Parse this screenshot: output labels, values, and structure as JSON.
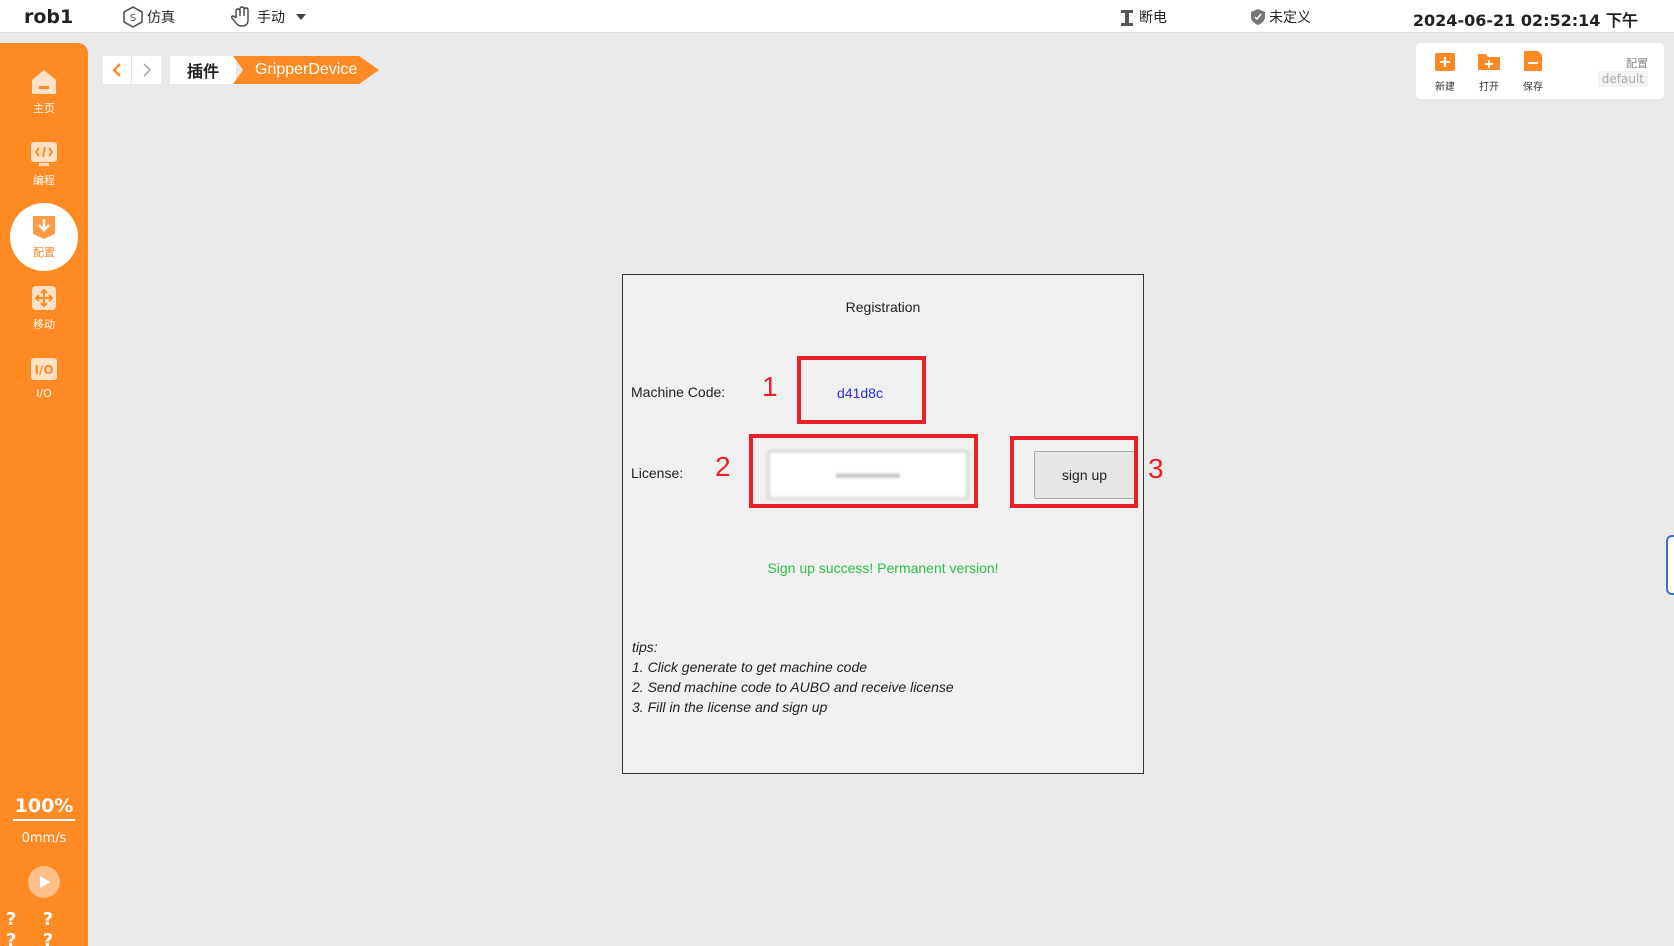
{
  "topbar": {
    "robot_name": "rob1",
    "mode_sim": "仿真",
    "mode_manual": "手动",
    "power_status": "断电",
    "safety_status": "未定义",
    "datetime": "2024-06-21 02:52:14 下午"
  },
  "sidebar": {
    "items": [
      {
        "label": "主页",
        "icon": "home-icon"
      },
      {
        "label": "编程",
        "icon": "code-icon"
      },
      {
        "label": "配置",
        "icon": "config-icon"
      },
      {
        "label": "移动",
        "icon": "move-icon"
      },
      {
        "label": "I/O",
        "icon": "io-icon"
      }
    ],
    "active": "配置",
    "speed_percent": "100%",
    "speed_value": "0mm/s",
    "bottom_marks": "? ? ? ?"
  },
  "breadcrumb": {
    "parent": "插件",
    "current": "GripperDevice"
  },
  "toolbar": {
    "new_label": "新建",
    "open_label": "打开",
    "save_label": "保存",
    "config_label": "配置",
    "config_value": "default"
  },
  "dialog": {
    "title": "Registration",
    "machine_code_label": "Machine Code:",
    "machine_code_value": "d41d8c",
    "license_label": "License:",
    "license_value": "••••••••••••••",
    "signup_label": "sign up",
    "success_message": "Sign up success! Permanent version!",
    "tips": [
      "tips:",
      "1. Click generate to get machine code",
      "2. Send machine code to AUBO and receive license",
      "3. Fill in the license and sign up"
    ]
  },
  "annotations": [
    "1",
    "2",
    "3"
  ],
  "colors": {
    "accent": "#ff8a24",
    "annotation": "#e8202a",
    "success": "#2fbf4c",
    "machine_code": "#2d2dd6"
  }
}
